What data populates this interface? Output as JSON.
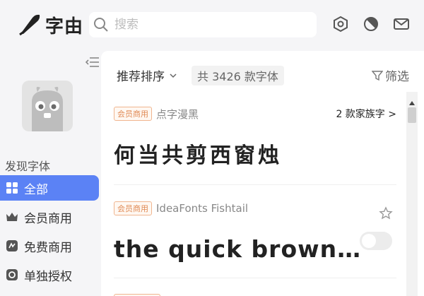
{
  "app": {
    "name": "字由"
  },
  "search": {
    "placeholder": "搜索"
  },
  "header_icons": [
    "settings-icon",
    "theme-icon",
    "mail-icon"
  ],
  "sidebar": {
    "section_title": "发现字体",
    "items": [
      {
        "label": "全部",
        "icon": "grid-icon",
        "active": true
      },
      {
        "label": "会员商用",
        "icon": "crown-icon",
        "active": false
      },
      {
        "label": "免费商用",
        "icon": "free-icon",
        "active": false
      },
      {
        "label": "单独授权",
        "icon": "license-icon",
        "active": false
      }
    ]
  },
  "toolbar": {
    "sort_label": "推荐排序",
    "count": "共 3426 款字体",
    "filter_label": "筛选"
  },
  "fonts": [
    {
      "badge": "会员商用",
      "name": "点字漫黑",
      "family_link": "2 款家族字 >",
      "preview": "何当共剪西窗烛"
    },
    {
      "badge": "会员商用",
      "name": "IdeaFonts Fishtail",
      "preview": "the quick brown…",
      "enabled": false
    }
  ],
  "colors": {
    "accent": "#5b82f5",
    "badge": "#e08a55",
    "background": "#f5f5f7"
  }
}
